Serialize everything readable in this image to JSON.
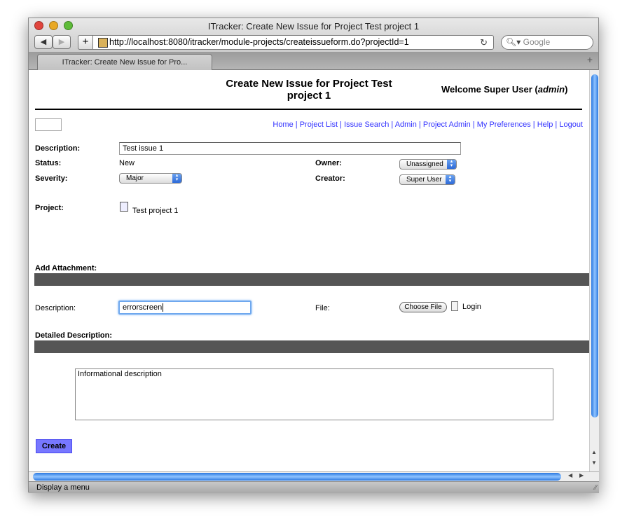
{
  "window": {
    "title": "ITracker: Create New Issue for Project Test project 1",
    "url": "http://localhost:8080/itracker/module-projects/createissueform.do?projectId=1",
    "search_placeholder": "Google",
    "tab_label": "ITracker: Create New Issue for Pro...",
    "status_text": "Display a menu"
  },
  "header": {
    "title": "Create New Issue for Project Test project 1",
    "welcome_prefix": "Welcome Super User (",
    "welcome_user": "admin",
    "welcome_suffix": ")"
  },
  "nav": [
    {
      "label": "Home"
    },
    {
      "label": "Project List"
    },
    {
      "label": "Issue Search"
    },
    {
      "label": "Admin"
    },
    {
      "label": "Project Admin"
    },
    {
      "label": "My Preferences"
    },
    {
      "label": "Help"
    },
    {
      "label": "Logout"
    }
  ],
  "form": {
    "description_label": "Description:",
    "description_value": "Test issue 1",
    "status_label": "Status:",
    "status_value": "New",
    "owner_label": "Owner:",
    "owner_value": "Unassigned",
    "severity_label": "Severity:",
    "severity_value": "Major",
    "creator_label": "Creator:",
    "creator_value": "Super User",
    "project_label": "Project:",
    "project_value": "Test project 1"
  },
  "attachment": {
    "section_label": "Add Attachment:",
    "description_label": "Description:",
    "description_value": "errorscreen",
    "file_label": "File:",
    "choose_file_label": "Choose File",
    "file_name": "Login"
  },
  "detail": {
    "section_label": "Detailed Description:",
    "text": "Informational description"
  },
  "create_label": "Create",
  "colors": {
    "link": "#3333ff",
    "section_bar": "#555555",
    "create_button": "#7777ff",
    "scroll_thumb": "#2a78e0"
  }
}
